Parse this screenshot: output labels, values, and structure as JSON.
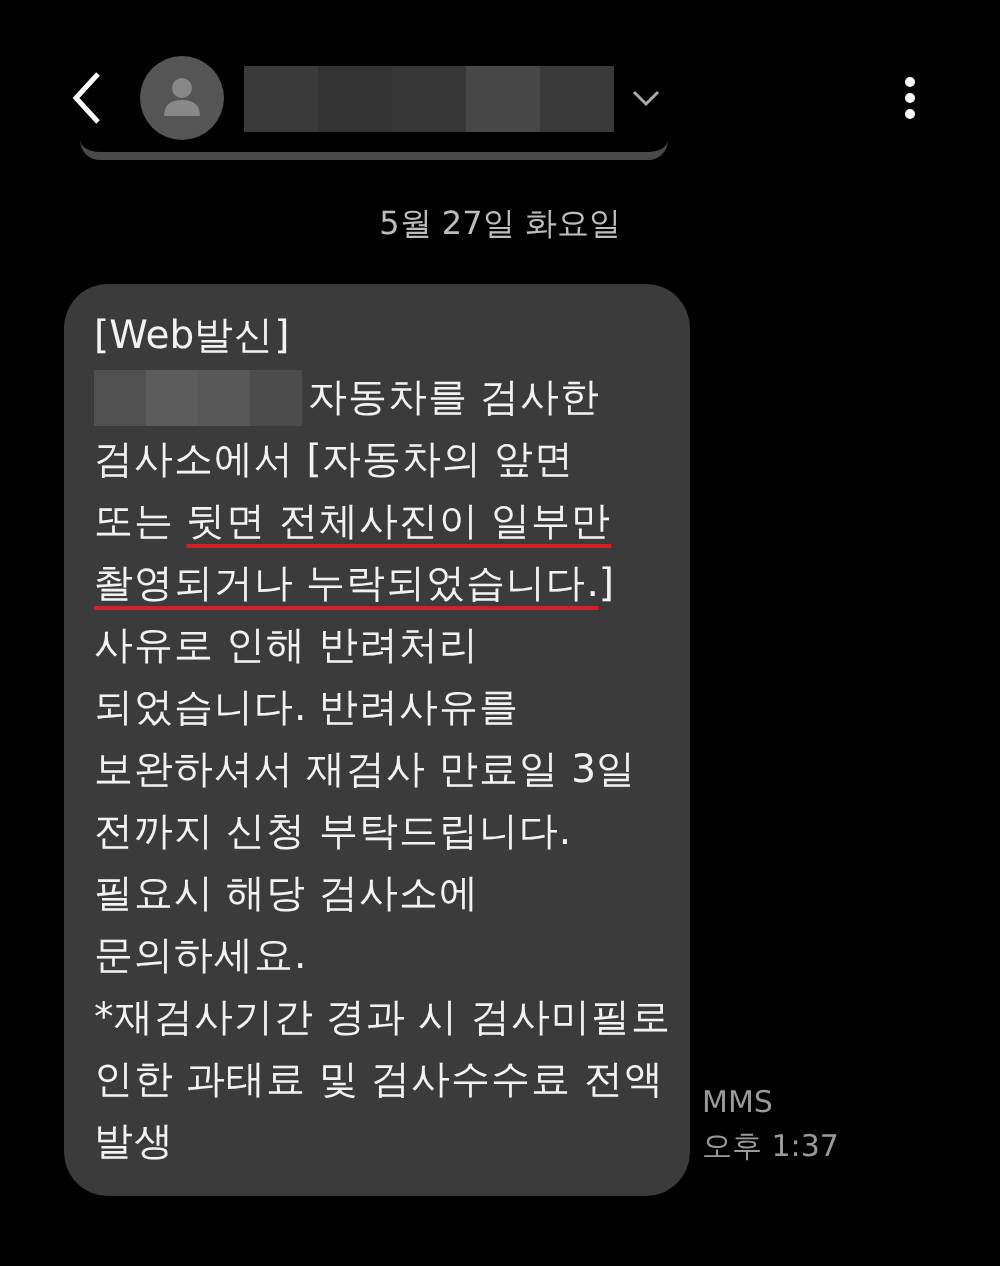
{
  "header": {
    "contact": {
      "kind": "redacted"
    }
  },
  "date_separator": "5월 27일 화요일",
  "message": {
    "lines": [
      [
        {
          "text": "[Web발신]"
        }
      ],
      [
        {
          "kind": "redacted"
        },
        {
          "text": "자동차를 검사한"
        }
      ],
      [
        {
          "text": "검사소에서 [자동차의 앞면"
        }
      ],
      [
        {
          "text": "또는 "
        },
        {
          "text": "뒷면 전체사진이 일부만",
          "underlined": true
        }
      ],
      [
        {
          "text": "촬영되거나 누락되었습니다.",
          "underlined": true
        },
        {
          "text": "]"
        }
      ],
      [
        {
          "text": "사유로 인해 반려처리"
        }
      ],
      [
        {
          "text": "되었습니다. 반려사유를"
        }
      ],
      [
        {
          "text": "보완하셔서 재검사 만료일 3일"
        }
      ],
      [
        {
          "text": "전까지 신청 부탁드립니다."
        }
      ],
      [
        {
          "text": "필요시 해당 검사소에"
        }
      ],
      [
        {
          "text": "문의하세요."
        }
      ],
      [
        {
          "text": "*재검사기간 경과 시 검사미필로"
        }
      ],
      [
        {
          "text": "인한 과태료 및 검사수수료 전액"
        }
      ],
      [
        {
          "text": "발생"
        }
      ]
    ],
    "type": "MMS",
    "time": "오후 1:37"
  }
}
